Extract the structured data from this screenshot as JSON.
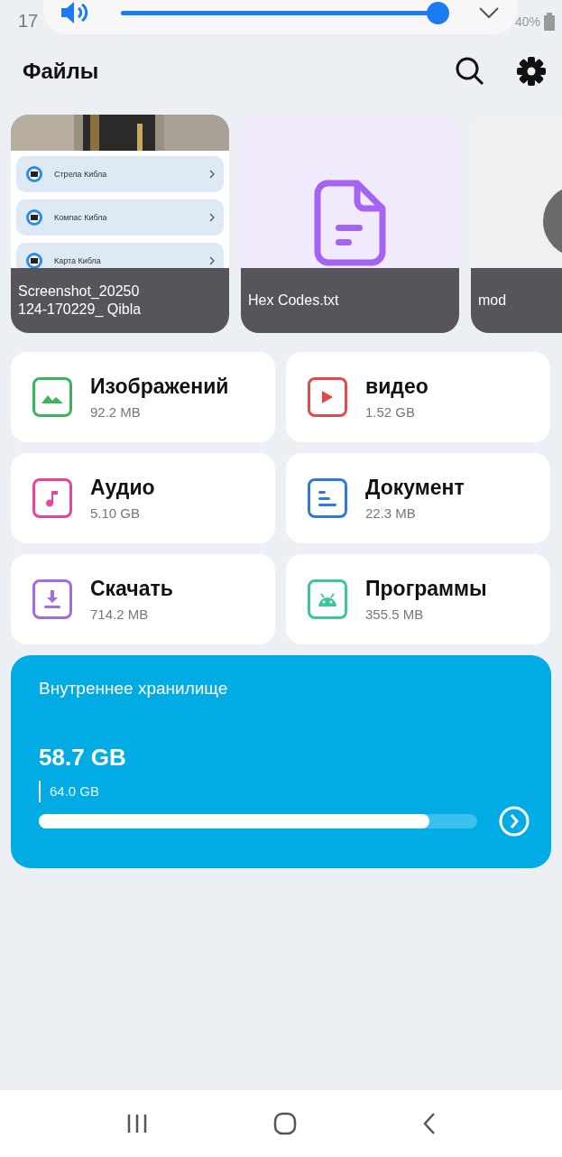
{
  "status_bar": {
    "time": "17",
    "battery": "40%"
  },
  "volume": {
    "level": 0.97
  },
  "header": {
    "title": "Файлы"
  },
  "recent": [
    {
      "kind": "screenshot",
      "name": "Screenshot_20250\n124-170229_ Qibla",
      "rows": [
        "Стрела Кибла",
        "Компас Кибла",
        "Карта Кибла"
      ]
    },
    {
      "kind": "text",
      "name": "Hex Codes.txt"
    },
    {
      "kind": "folder",
      "name": "mod"
    }
  ],
  "categories": [
    {
      "kind": "images",
      "title": "Изображений",
      "size": "92.2 MB",
      "color": "#3cb55a"
    },
    {
      "kind": "video",
      "title": "видео",
      "size": "1.52 GB",
      "color": "#e24a4a"
    },
    {
      "kind": "audio",
      "title": "Аудио",
      "size": "5.10 GB",
      "color": "#e8449a"
    },
    {
      "kind": "document",
      "title": "Документ",
      "size": "22.3 MB",
      "color": "#2f7ad9"
    },
    {
      "kind": "download",
      "title": "Скачать",
      "size": "714.2 MB",
      "color": "#a36be0"
    },
    {
      "kind": "apps",
      "title": "Программы",
      "size": "355.5 MB",
      "color": "#3cc4a0"
    }
  ],
  "storage": {
    "title": "Внутреннее хранилище",
    "used": "58.7 GB",
    "total": "64.0 GB",
    "level": 0.89
  }
}
